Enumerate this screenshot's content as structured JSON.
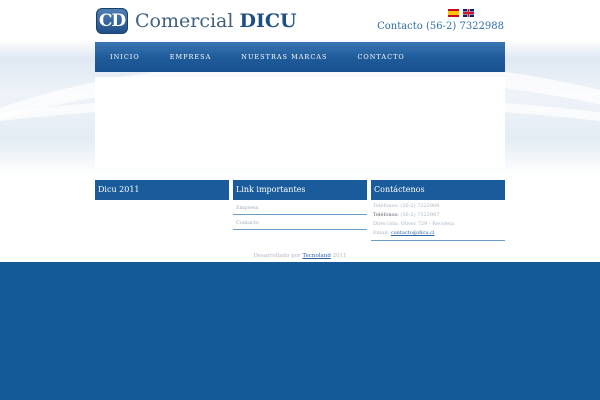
{
  "header": {
    "logo_mark": "CD",
    "logo_word": "Comercial",
    "logo_bold": "DICU",
    "contact_phone": "Contacto (56-2) 7322988"
  },
  "languages": [
    "spanish-flag-icon",
    "uk-flag-icon"
  ],
  "nav": {
    "items": [
      "INICIO",
      "EMPRESA",
      "NUESTRAS MARCAS",
      "CONTACTO"
    ]
  },
  "footer": {
    "col1": {
      "title": "Dicu 2011"
    },
    "col2": {
      "title": "Link importantes",
      "links": [
        "Empresa",
        "Contacto"
      ]
    },
    "col3": {
      "title": "Contáctenos",
      "phone": "Teléfonos: (56-2) 7322988",
      "phone_strong_label": "Teléfonos:",
      "phone_strong_value": " (56-2) 7322987",
      "address": "Dirección: Oliver 729 - Recoleta",
      "email_label": "Email: ",
      "email": "contacto@dicu.cl"
    },
    "credit_prefix": "Desarrollado por ",
    "credit_link": "Tecnoland",
    "credit_suffix": " 2011"
  },
  "colors": {
    "nav_blue": "#1e5a99",
    "footer_blue": "#135a96",
    "header_blue": "#1a5c9b"
  }
}
